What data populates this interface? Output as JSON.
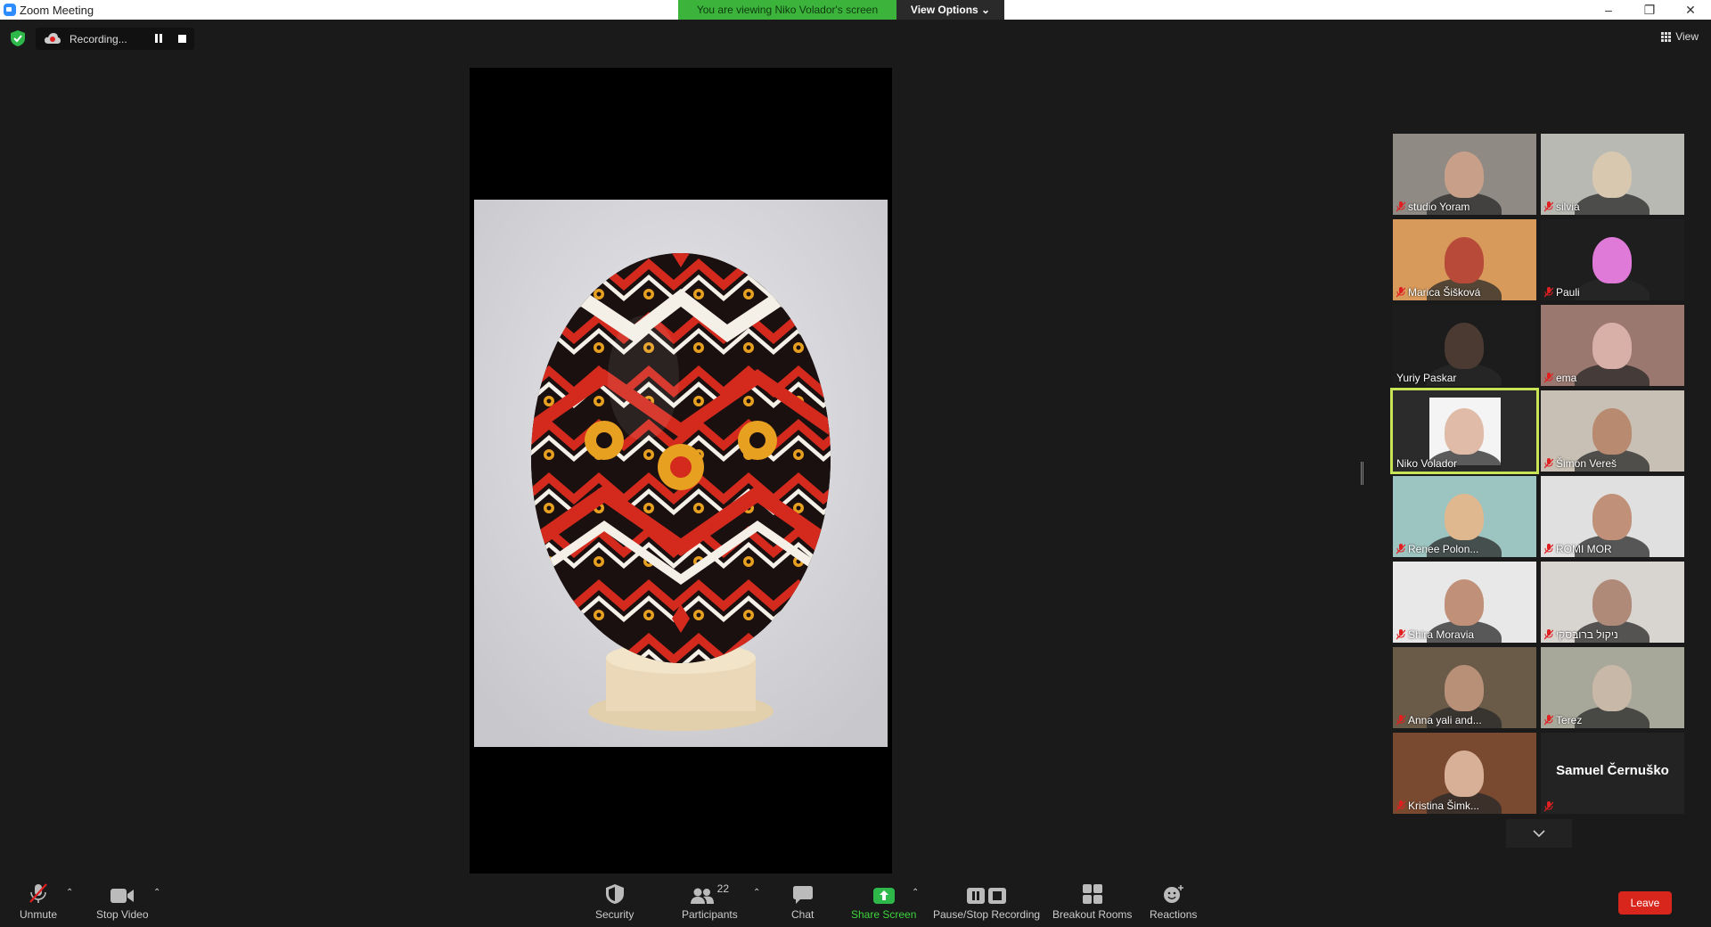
{
  "window": {
    "title": "Zoom Meeting",
    "controls": [
      "–",
      "❐",
      "✕"
    ]
  },
  "banner": {
    "viewing_text": "You are viewing Niko Volador's screen",
    "view_options_label": "View Options ⌄"
  },
  "top_toolbar": {
    "recording_label": "Recording...",
    "view_label": "View"
  },
  "gallery": [
    {
      "name": "studio Yoram",
      "muted": true,
      "bg": "#8f8a84",
      "skin": "#c8a08a"
    },
    {
      "name": "silvia",
      "muted": true,
      "bg": "#b9b9b4",
      "skin": "#d8c8b0"
    },
    {
      "name": "Marica Šišková",
      "muted": true,
      "bg": "#d89a5a",
      "skin": "#b84a3a"
    },
    {
      "name": "Pauli",
      "muted": true,
      "bg": "#1e1e1e",
      "skin": "#e07ad8"
    },
    {
      "name": "Yuriy Paskar",
      "muted": false,
      "bg": "#1c1c1c",
      "skin": "#4a3a32"
    },
    {
      "name": "ema",
      "muted": true,
      "bg": "#9a7870",
      "skin": "#d8b0a8"
    },
    {
      "name": "Niko Volador",
      "muted": false,
      "bg": "#2b2b2b",
      "skin": "#e0bca8",
      "active": true
    },
    {
      "name": "Šimon Vereš",
      "muted": true,
      "bg": "#c8c0b4",
      "skin": "#b88a70"
    },
    {
      "name": "Renee Polon...",
      "muted": true,
      "bg": "#9cc4c0",
      "skin": "#e0b890"
    },
    {
      "name": "ROMI MOR",
      "muted": true,
      "bg": "#e0e0e0",
      "skin": "#c09078"
    },
    {
      "name": "Shira Moravia",
      "muted": true,
      "bg": "#e8e8e8",
      "skin": "#c09078"
    },
    {
      "name": "ניקול ברובסקי",
      "muted": true,
      "bg": "#d8d4d0",
      "skin": "#b08a78"
    },
    {
      "name": "Anna yali and...",
      "muted": true,
      "bg": "#6a5a48",
      "skin": "#b89078"
    },
    {
      "name": "Terez",
      "muted": true,
      "bg": "#a8a89a",
      "skin": "#c8b8a8"
    },
    {
      "name": "Kristina Šimk...",
      "muted": true,
      "bg": "#7a4a30",
      "skin": "#d8b098"
    },
    {
      "name": "Samuel Černuško",
      "muted": true,
      "no_video": true
    }
  ],
  "bottom_toolbar": {
    "unmute": "Unmute",
    "stop_video": "Stop Video",
    "security": "Security",
    "participants": "Participants",
    "participant_count": "22",
    "chat": "Chat",
    "share_screen": "Share Screen",
    "pause_stop_recording": "Pause/Stop Recording",
    "breakout_rooms": "Breakout Rooms",
    "reactions": "Reactions",
    "leave": "Leave"
  },
  "colors": {
    "banner_green": "#3cb43c",
    "active_speaker": "#c7e356",
    "leave_red": "#d9261c",
    "share_green": "#3cd43c",
    "mic_off_red": "#e02020"
  }
}
